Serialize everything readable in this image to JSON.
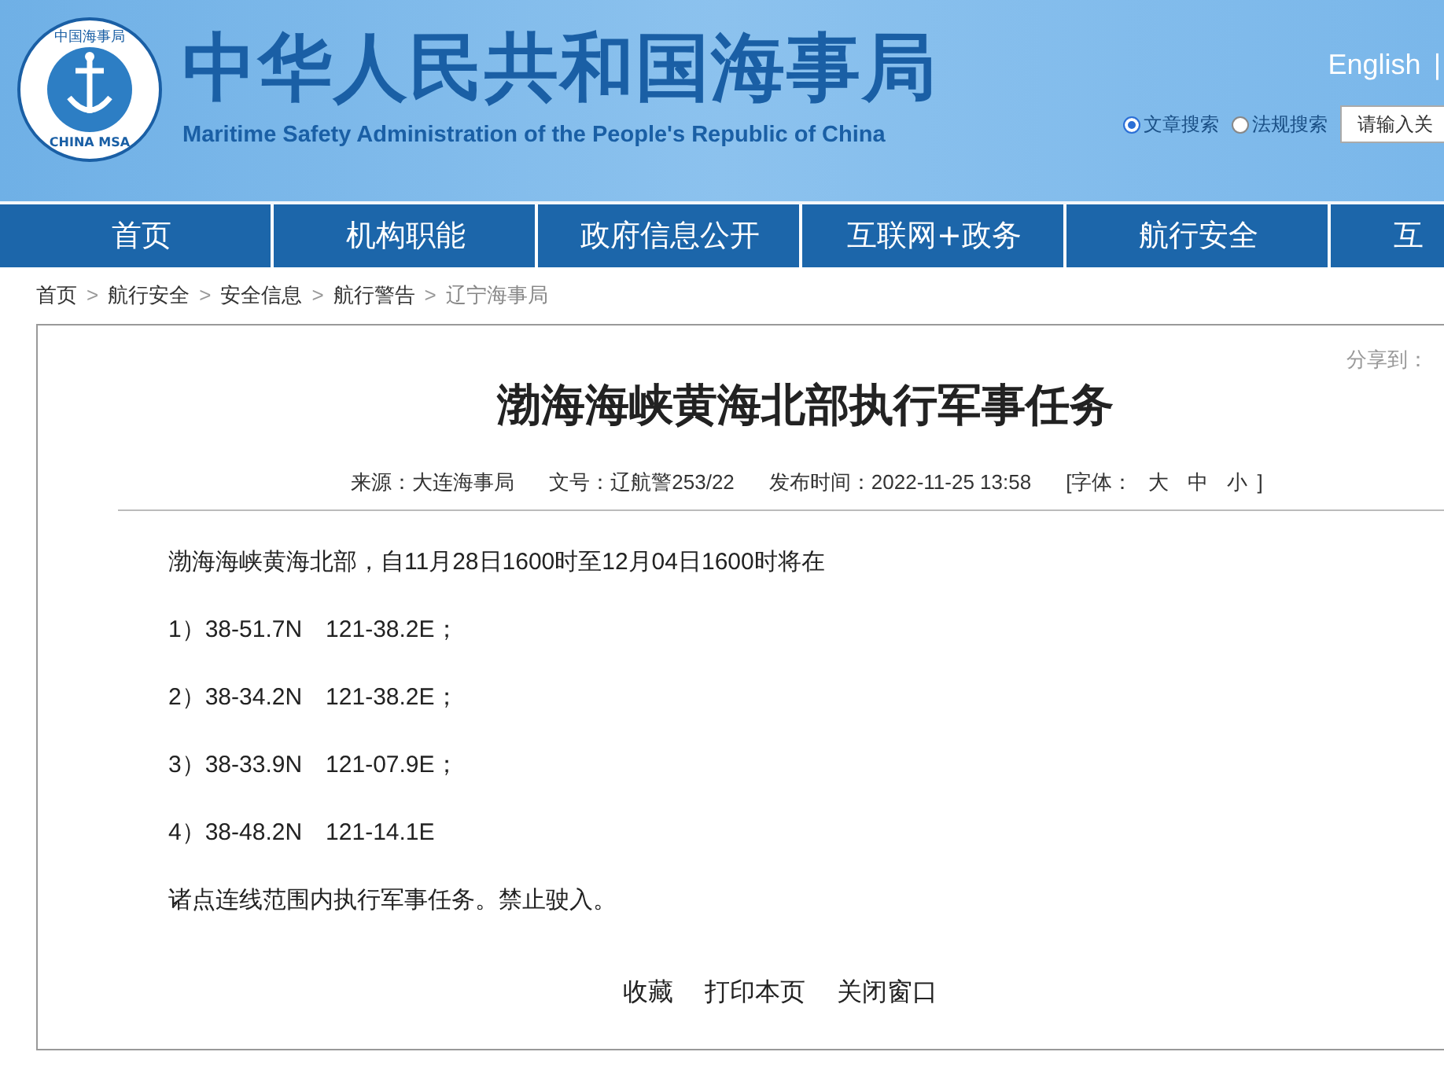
{
  "header": {
    "logo_ring_top": "中国海事局",
    "logo_ring_bottom": "CHINA MSA",
    "title": "中华人民共和国海事局",
    "subtitle": "Maritime Safety Administration of the People's Republic of China",
    "language_link": "English",
    "separator": "|",
    "search_options": [
      {
        "label": "文章搜索",
        "selected": true
      },
      {
        "label": "法规搜索",
        "selected": false
      }
    ],
    "search": {
      "placeholder": "请输入关"
    }
  },
  "nav": [
    {
      "label": "首页"
    },
    {
      "label": "机构职能"
    },
    {
      "label": "政府信息公开"
    },
    {
      "label": "互联网+政务"
    },
    {
      "label": "航行安全"
    },
    {
      "label": "互"
    }
  ],
  "breadcrumb_separator": ">",
  "breadcrumb": [
    {
      "label": "首页"
    },
    {
      "label": "航行安全"
    },
    {
      "label": "安全信息"
    },
    {
      "label": "航行警告"
    },
    {
      "label": "辽宁海事局"
    }
  ],
  "article": {
    "share_label": "分享到：",
    "title": "渤海海峡黄海北部执行军事任务",
    "meta": [
      {
        "label": "来源：",
        "value": "大连海事局"
      },
      {
        "label": "文号：",
        "value": "辽航警253/22"
      },
      {
        "label": "发布时间：",
        "value": "2022-11-25 13:58"
      }
    ],
    "font_size": {
      "open": "[字体：",
      "options": [
        "大",
        "中",
        "小"
      ],
      "close": "]"
    },
    "paragraphs": [
      "渤海海峡黄海北部，自11月28日1600时至12月04日1600时将在",
      "1）38-51.7N　121-38.2E；",
      "2）38-34.2N　121-38.2E；",
      "3）38-33.9N　121-07.9E；",
      "4）38-48.2N　121-14.1E",
      "诸点连线范围内执行军事任务。禁止驶入。"
    ],
    "actions": [
      "收藏",
      "打印本页",
      "关闭窗口"
    ]
  }
}
